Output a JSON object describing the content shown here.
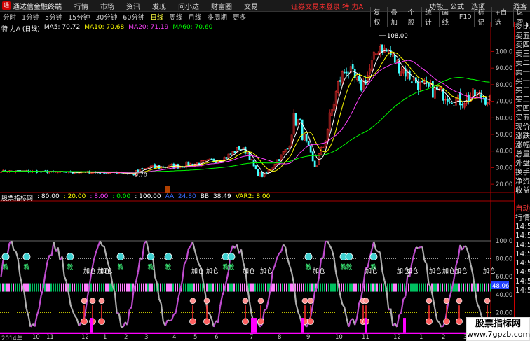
{
  "app": {
    "title": "通达信金融终端",
    "menu": [
      "行情",
      "市场",
      "资讯",
      "发现",
      "问小达",
      "财富圈",
      "交易"
    ],
    "notice": "证券交易未登录  特 力A",
    "right_menu": [
      "功能",
      "公式",
      "选项",
      "游客"
    ]
  },
  "toolbar": {
    "periods": [
      "分时",
      "1分钟",
      "5分钟",
      "15分钟",
      "30分钟",
      "60分钟",
      "日线",
      "周线",
      "月线",
      "多周期",
      "更多"
    ],
    "active_period": "日线",
    "right_buttons": [
      "复权",
      "叠加",
      "个股",
      "统计",
      "画线",
      "F10",
      "标记",
      "+自选",
      "返回"
    ]
  },
  "main_legend": {
    "name": "特 力A (日线)",
    "ma5": "MA5: 70.72",
    "ma10": "MA10: 70.68",
    "ma20": "MA20: 71.19",
    "ma60": "MA60: 70.60"
  },
  "main_yaxis": [
    "100.0",
    "90.00",
    "80.00",
    "70.00",
    "60.00",
    "50.00",
    "40.00",
    "30.00",
    "20.00"
  ],
  "price_annotations": {
    "high": "108.00",
    "low": "9.70"
  },
  "indicator_legend": {
    "name": "股票指标网",
    "v1": ": 80.00",
    "v2": ": 20.00",
    "v3": ": 8.00",
    "v4": ": 0.00",
    "v5": ": 100.00",
    "aa": "AA: 24.80",
    "bb": "BB: 38.49",
    "var2": "VAR2: 8.00"
  },
  "indicator_yaxis": [
    "100.0",
    "80.00",
    "60.00",
    "40.00",
    "20.00"
  ],
  "indicator_current": "48.06",
  "signal_text": {
    "add": "加仓",
    "jiao": "教",
    "zhang": "涨"
  },
  "right_panel": {
    "tag": "L",
    "rows": [
      "委比",
      "卖五",
      "卖四",
      "卖三",
      "卖二",
      "卖一",
      "买一",
      "买二",
      "买三",
      "买四",
      "买五",
      "现价",
      "涨跌",
      "涨幅",
      "总量",
      "外盘",
      "换手",
      "净资",
      "收益",
      "",
      "自动",
      "行情",
      "14:50",
      "14:50",
      "14:50",
      "14:50",
      "14:50",
      "14:50",
      "14:50",
      "14:50"
    ]
  },
  "xaxis": [
    "2014年",
    "10",
    "11",
    "12",
    "1",
    "2",
    "3",
    "4",
    "5",
    "6",
    "7",
    "8",
    "9",
    "10",
    "11",
    "12",
    "1",
    "2",
    "3"
  ],
  "watermark": {
    "line1": "股票指标网",
    "line2": "www.7gpzb.com"
  },
  "colors": {
    "up": "#ff3030",
    "down": "#40ffff",
    "ma5": "#ffffff",
    "ma10": "#ffff00",
    "ma20": "#ff40ff",
    "ma60": "#00ff00",
    "indicator_line": "#c04cd0",
    "pink_band": "#ff80ff"
  }
}
